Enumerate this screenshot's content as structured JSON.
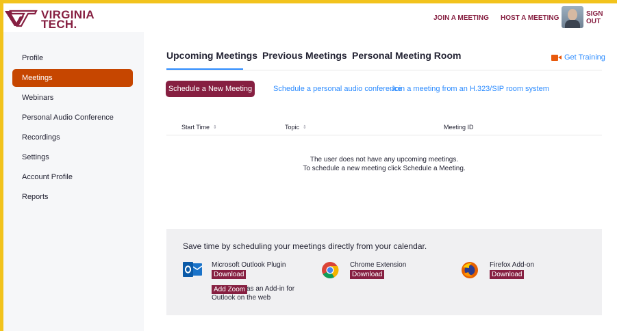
{
  "colors": {
    "frame": "#f2c31c",
    "maroon": "#861f41",
    "orange_active": "#c64600",
    "link_blue": "#2d8cff"
  },
  "header": {
    "logo_line1": "VIRGINIA",
    "logo_line2": "TECH.",
    "join_meeting": "JOIN A MEETING",
    "host_meeting": "HOST A MEETING",
    "sign_out": "SIGN OUT"
  },
  "sidebar": {
    "items": [
      {
        "label": "Profile",
        "active": false
      },
      {
        "label": "Meetings",
        "active": true
      },
      {
        "label": "Webinars",
        "active": false
      },
      {
        "label": "Personal Audio Conference",
        "active": false
      },
      {
        "label": "Recordings",
        "active": false
      },
      {
        "label": "Settings",
        "active": false
      },
      {
        "label": "Account Profile",
        "active": false
      },
      {
        "label": "Reports",
        "active": false
      }
    ]
  },
  "tabs": [
    {
      "label": "Upcoming Meetings",
      "active": true
    },
    {
      "label": "Previous Meetings",
      "active": false
    },
    {
      "label": "Personal Meeting Room",
      "active": false
    }
  ],
  "get_training": "Get Training",
  "actions": {
    "schedule_button": "Schedule a New Meeting",
    "audio_conference_link": "Schedule a personal audio conference",
    "h323_link": "Join a meeting from an H.323/SIP room system"
  },
  "table": {
    "columns": [
      "Start Time",
      "Topic",
      "Meeting ID"
    ],
    "empty_line1": "The user does not have any upcoming meetings.",
    "empty_line2": "To schedule a new meeting click Schedule a Meeting."
  },
  "calendar_panel": {
    "title": "Save time by scheduling your meetings directly from your calendar.",
    "outlook": {
      "name": "Microsoft Outlook Plugin",
      "download": "Download",
      "icon": "outlook-icon"
    },
    "chrome": {
      "name": "Chrome Extension",
      "download": "Download",
      "icon": "chrome-icon"
    },
    "firefox": {
      "name": "Firefox Add-on",
      "download": "Download",
      "icon": "firefox-icon"
    },
    "add_zoom": "Add Zoom",
    "add_zoom_suffix": "as an Add-in for",
    "add_zoom_line2": "Outlook on the web"
  }
}
